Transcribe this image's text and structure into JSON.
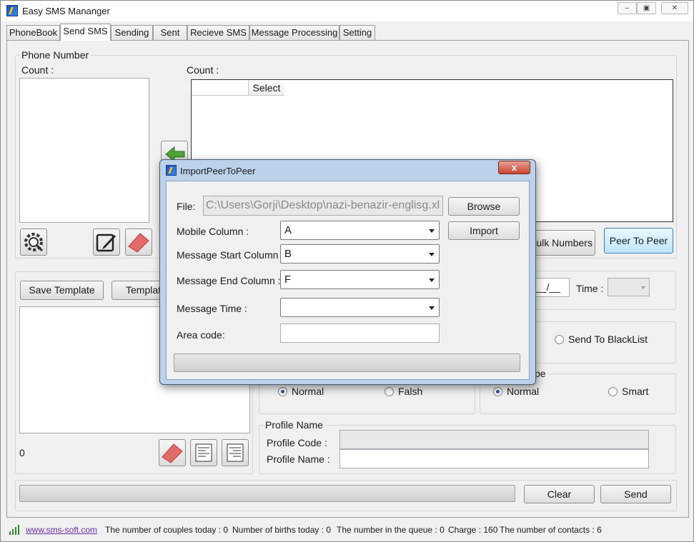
{
  "window": {
    "title": "Easy SMS Mananger"
  },
  "tabs": [
    "PhoneBook",
    "Send SMS",
    "Sending",
    "Sent",
    "Recieve SMS",
    "Message Processing",
    "Setting"
  ],
  "phone_number_group": {
    "label": "Phone Number",
    "count_left": "Count :",
    "count_right": "Count :",
    "grid_header_select": "Select"
  },
  "buttons": {
    "bulk_numbers": "Bulk Numbers",
    "peer_to_peer": "Peer To Peer",
    "save_template": "Save Template",
    "template": "Template",
    "clear": "Clear",
    "send": "Send"
  },
  "schedule": {
    "date_fragment": "__/__",
    "time_label": "Time :"
  },
  "blacklist": {
    "label": "Send To BlackList"
  },
  "send_type_group": {
    "label_fragment": "pe",
    "options": [
      "Normal",
      "Falsh"
    ]
  },
  "message_type_group": {
    "options": [
      "Normal",
      "Smart"
    ]
  },
  "template_area": {
    "char_count": "0"
  },
  "profile_group": {
    "label": "Profile Name",
    "code_label": "Profile Code :",
    "name_label": "Profile Name :"
  },
  "dialog": {
    "title": "ImportPeerToPeer",
    "close_glyph": "x",
    "file_label": "File:",
    "file_value": "C:\\Users\\Gorji\\Desktop\\nazi-benazir-englisg.xl",
    "mobile_column_label": "Mobile Column :",
    "mobile_column_value": "A",
    "msg_start_label": "Message Start Column :",
    "msg_start_value": "B",
    "msg_end_label": "Message End Column :",
    "msg_end_value": "F",
    "msg_time_label": "Message Time :",
    "msg_time_value": "",
    "area_code_label": "Area code:",
    "area_code_value": "",
    "browse": "Browse",
    "import": "Import"
  },
  "statusbar": {
    "link": "www.sms-soft.com",
    "couples": "The number of couples today : 0",
    "births": "Number of births today : 0",
    "queue": "The number in the queue : 0",
    "charge": "Charge : 160",
    "contacts": "The number of contacts : 6"
  }
}
